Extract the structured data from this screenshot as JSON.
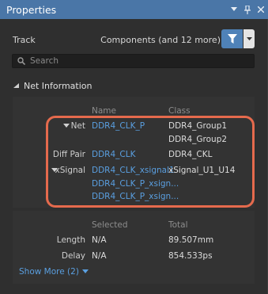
{
  "window": {
    "title": "Properties"
  },
  "filter": {
    "object_type": "Track",
    "selection": "Components (and 12 more)"
  },
  "search": {
    "placeholder": "Search"
  },
  "net_information": {
    "section_title": "Net Information",
    "columns": {
      "name": "Name",
      "class": "Class"
    },
    "rows": [
      {
        "label": "Net",
        "name": "DDR4_CLK_P",
        "classes": [
          "DDR4_Group1",
          "DDR4_Group2"
        ]
      },
      {
        "label": "Diff Pair",
        "name": "DDR4_CLK",
        "classes": [
          "DDR4_CKL"
        ]
      },
      {
        "label": "xSignal",
        "names": [
          "DDR4_CLK_xsignal1",
          "DDR4_CLK_P_xsign...",
          "DDR4_CLK_P_xsign..."
        ],
        "classes": [
          "xSignal_U1_U14"
        ]
      }
    ]
  },
  "length_info": {
    "columns": {
      "selected": "Selected",
      "total": "Total"
    },
    "rows": [
      {
        "label": "Length",
        "selected": "N/A",
        "total": "89.507mm"
      },
      {
        "label": "Delay",
        "selected": "N/A",
        "total": "854.533ps"
      }
    ],
    "show_more": "Show More (2)"
  },
  "colors": {
    "titlebar": "#4a76a7",
    "link": "#5a9fe0",
    "highlight": "#e56a4d"
  }
}
